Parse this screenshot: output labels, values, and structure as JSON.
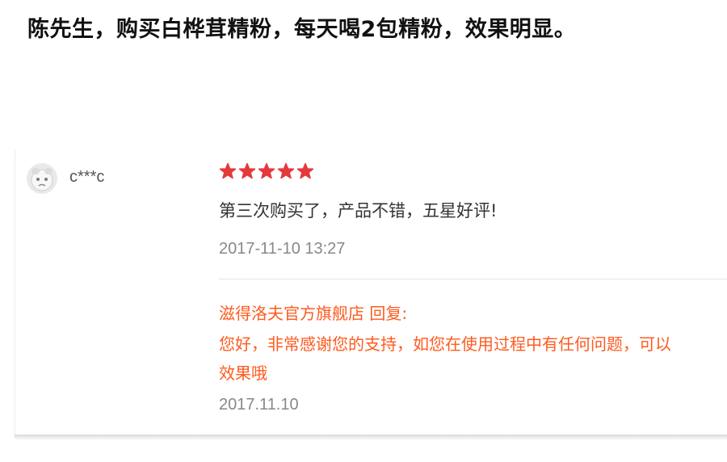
{
  "headline": "陈先生，购买白桦茸精粉，每天喝2包精粉，效果明显。",
  "review": {
    "avatar_icon": "avatar-icon",
    "username": "c***c",
    "rating": 5,
    "rating_max": 5,
    "star_color": "#e4393c",
    "comment": "第三次购买了，产品不错，五星好评!",
    "date": "2017-11-10 13:27",
    "reply": {
      "heading": "滋得洛夫官方旗舰店 回复:",
      "lines": [
        "您好，非常感谢您的支持，如您在使用过程中有任何问题，可以",
        "效果哦"
      ],
      "date": "2017.11.10",
      "color": "#ff5a1f"
    }
  }
}
